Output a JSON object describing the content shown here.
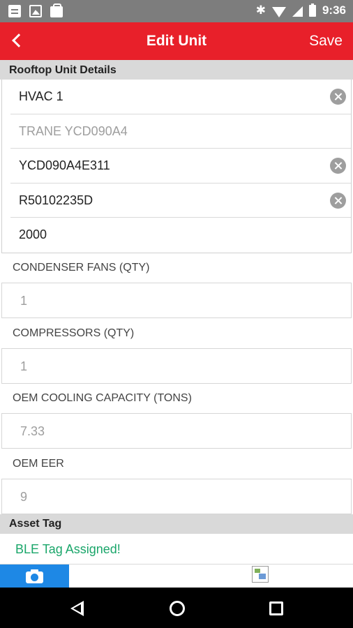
{
  "status_bar": {
    "time": "9:36",
    "bluetooth_symbol": "✱",
    "left_icons": [
      "document-icon",
      "image-icon",
      "bag-icon"
    ],
    "right_icons": [
      "bluetooth-icon",
      "wifi-icon",
      "signal-icon",
      "battery-icon"
    ]
  },
  "app_bar": {
    "title": "Edit Unit",
    "save_label": "Save",
    "back_icon": "chevron-left-icon"
  },
  "rooftop": {
    "header": "Rooftop Unit Details",
    "fields": [
      {
        "value": "HVAC 1",
        "placeholder": "",
        "clearable": true
      },
      {
        "value": "",
        "placeholder": "TRANE YCD090A4",
        "clearable": false
      },
      {
        "value": "YCD090A4E311",
        "placeholder": "",
        "clearable": true
      },
      {
        "value": "R50102235D",
        "placeholder": "",
        "clearable": true
      },
      {
        "value": "2000",
        "placeholder": "",
        "clearable": false
      }
    ]
  },
  "condenser_fans": {
    "label": "CONDENSER FANS (QTY)",
    "value": "1"
  },
  "compressors": {
    "label": "COMPRESSORS (QTY)",
    "value": "1"
  },
  "cooling_capacity": {
    "label": "OEM COOLING CAPACITY (TONS)",
    "value": "7.33"
  },
  "oem_eer": {
    "label": "OEM EER",
    "value": "9"
  },
  "asset_tag": {
    "header": "Asset Tag",
    "status": "BLE Tag Assigned!",
    "status_color": "#1aa66a"
  },
  "tabs": {
    "camera_icon": "camera-icon",
    "image_icon": "broken-image-icon"
  },
  "colors": {
    "accent": "#e8202a",
    "tab_active": "#1e88e5",
    "section_bg": "#d9d9d9"
  }
}
